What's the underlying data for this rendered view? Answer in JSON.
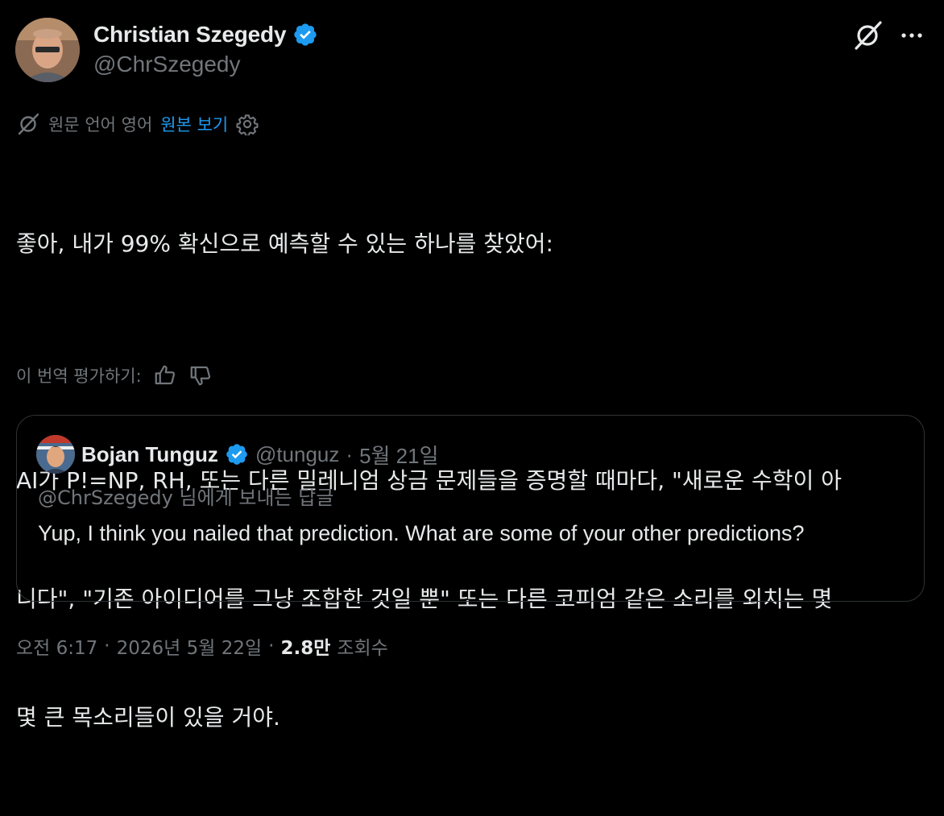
{
  "author": {
    "name": "Christian Szegedy",
    "handle": "@ChrSzegedy"
  },
  "icons": {
    "verified": "verified-badge-icon",
    "grok": "grok-icon",
    "more": "more-icon",
    "translate": "translate-icon",
    "settings": "gear-icon",
    "thumbs_up": "thumbs-up-icon",
    "thumbs_down": "thumbs-down-icon"
  },
  "colors": {
    "background": "#000000",
    "text": "#e7e9ea",
    "secondary": "#71767b",
    "link": "#1d9bf0",
    "border": "#2f3336"
  },
  "translation": {
    "language_note": "원문 언어 영어",
    "show_original": "원본 보기"
  },
  "tweet": {
    "line1": "좋아, 내가 99% 확신으로 예측할 수 있는 하나를 찾았어:",
    "line2": "AI가 P!=NP, RH, 또는 다른 밀레니엄 상금 문제들을 증명할 때마다, \"새로운 수학이 아",
    "line3": "니다\", \"기존 아이디어를 그냥 조합한 것일 뿐\" 또는 다른 코피엄 같은 소리를 외치는 몇",
    "line4": "몇 큰 목소리들이 있을 거야."
  },
  "rate_translation": {
    "label": "이 번역 평가하기:"
  },
  "quote": {
    "name": "Bojan Tunguz",
    "handle": "@tunguz",
    "separator": "·",
    "date": "5월 21일",
    "replying_to": "@ChrSzegedy 님에게 보내는 답글",
    "text": "Yup, I think you nailed that prediction. What are some of your other predictions?"
  },
  "footer": {
    "time": "오전 6:17",
    "separator1": "·",
    "date": "2026년 5월 22일",
    "separator2": "·",
    "views_count": "2.8만",
    "views_label": "조회수"
  }
}
